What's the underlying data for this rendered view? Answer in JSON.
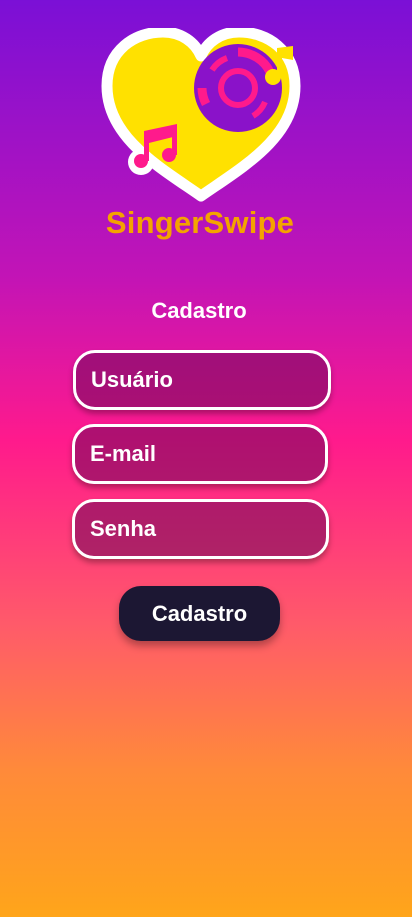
{
  "app": {
    "name": "SingerSwipe",
    "logo_icon": "heart-vinyl-music-logo"
  },
  "form": {
    "title": "Cadastro",
    "username_placeholder": "Usuário",
    "email_placeholder": "E-mail",
    "password_placeholder": "Senha",
    "submit_label": "Cadastro"
  },
  "colors": {
    "brand_orange": "#f4a300",
    "heart_yellow": "#ffe100",
    "vinyl_purple": "#8a12c9",
    "note_pink": "#ff1a8c",
    "button_dark": "#1c1733"
  }
}
